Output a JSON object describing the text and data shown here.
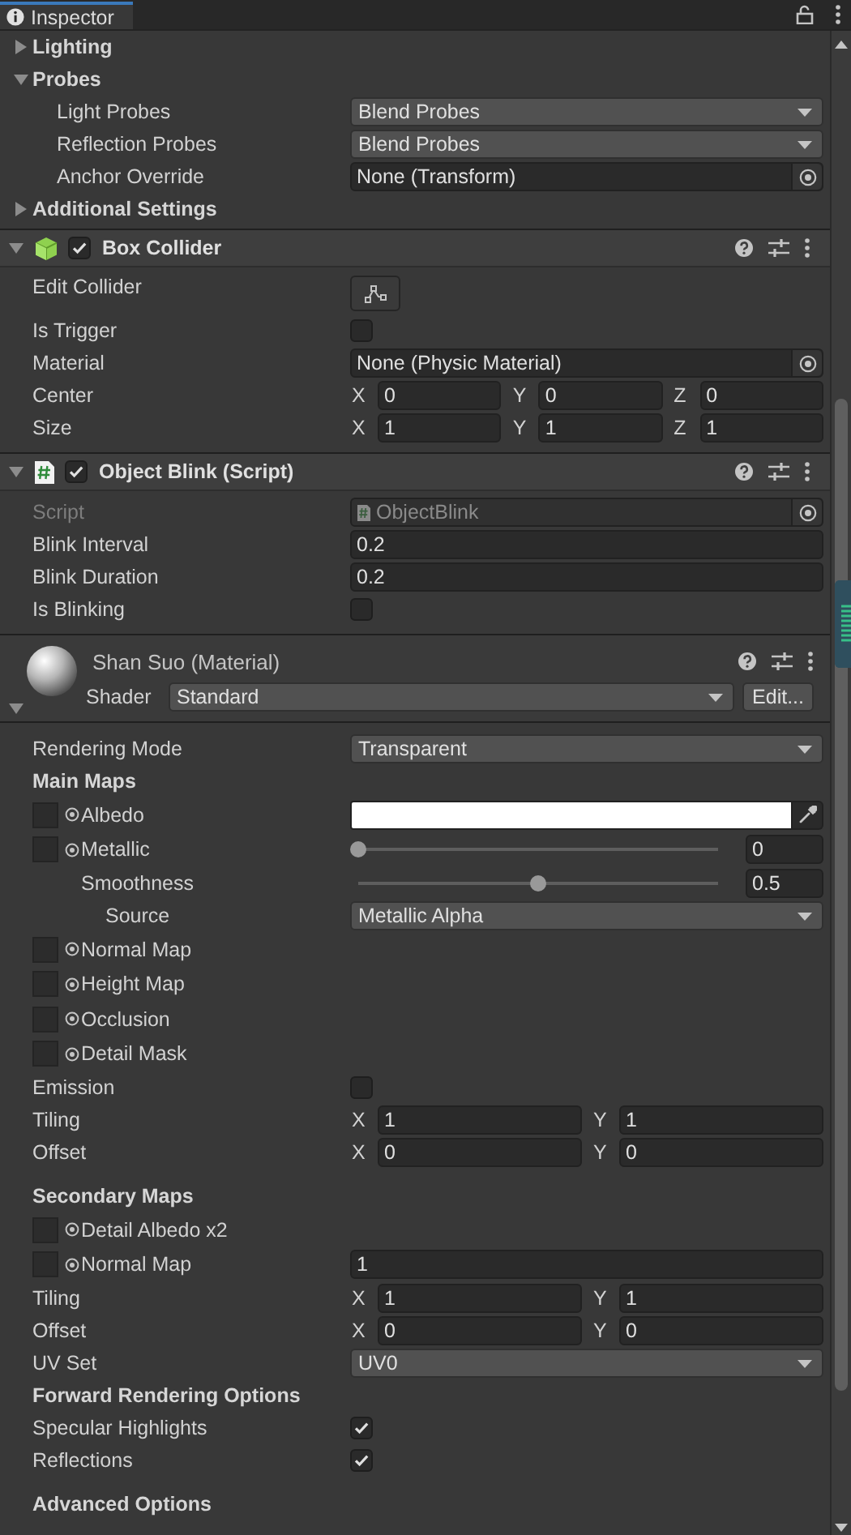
{
  "tab": {
    "title": "Inspector",
    "selected": true
  },
  "components": [
    {
      "kind": "plain",
      "rows": [
        {
          "kind": "foldout",
          "label": "Lighting",
          "expanded": false
        },
        {
          "kind": "foldout",
          "label": "Probes",
          "expanded": true,
          "children": [
            {
              "kind": "dropdown",
              "label": "Light Probes",
              "value": "Blend Probes"
            },
            {
              "kind": "dropdown",
              "label": "Reflection Probes",
              "value": "Blend Probes"
            },
            {
              "kind": "object",
              "label": "Anchor Override",
              "value": "None (Transform)"
            }
          ]
        },
        {
          "kind": "foldout",
          "label": "Additional Settings",
          "expanded": false
        }
      ]
    },
    {
      "kind": "collider",
      "title": "Box Collider",
      "expanded": true,
      "enabled": true,
      "rows": [
        {
          "kind": "button",
          "label": "Edit Collider"
        },
        {
          "kind": "checkbox",
          "label": "Is Trigger",
          "checked": false
        },
        {
          "kind": "object",
          "label": "Material",
          "value": "None (Physic Material)"
        },
        {
          "kind": "vector",
          "label": "Center",
          "fields": [
            {
              "axis": "X",
              "value": "0"
            },
            {
              "axis": "Y",
              "value": "0"
            },
            {
              "axis": "Z",
              "value": "0"
            }
          ]
        },
        {
          "kind": "vector",
          "label": "Size",
          "fields": [
            {
              "axis": "X",
              "value": "1"
            },
            {
              "axis": "Y",
              "value": "1"
            },
            {
              "axis": "Z",
              "value": "1"
            }
          ]
        }
      ]
    },
    {
      "kind": "script",
      "title": "Object Blink (Script)",
      "expanded": true,
      "enabled": true,
      "rows": [
        {
          "kind": "object",
          "label": "Script",
          "value": "ObjectBlink",
          "disabled": true
        },
        {
          "kind": "text",
          "label": "Blink Interval",
          "value": "0.2"
        },
        {
          "kind": "text",
          "label": "Blink Duration",
          "value": "0.2"
        },
        {
          "kind": "checkbox",
          "label": "Is Blinking",
          "checked": false
        }
      ]
    },
    {
      "kind": "material",
      "title": "Shan Suo (Material)",
      "shader_label": "Shader",
      "shader": "Standard",
      "edit_button": "Edit...",
      "expanded": true,
      "rows": [
        {
          "kind": "dropdown",
          "label": "Rendering Mode",
          "value": "Transparent"
        },
        {
          "kind": "header",
          "label": "Main Maps"
        },
        {
          "kind": "texcolor",
          "label": "Albedo",
          "color": "#ffffff"
        },
        {
          "kind": "texslider",
          "label": "Metallic",
          "level": 0,
          "value": "0",
          "children": [
            {
              "kind": "slider",
              "label": "Smoothness",
              "level": 0.5,
              "value": "0.5",
              "children": [
                {
                  "kind": "dropdown",
                  "label": "Source",
                  "value": "Metallic Alpha"
                }
              ]
            }
          ]
        },
        {
          "kind": "texture",
          "label": "Normal Map"
        },
        {
          "kind": "texture",
          "label": "Height Map"
        },
        {
          "kind": "texture",
          "label": "Occlusion"
        },
        {
          "kind": "texture",
          "label": "Detail Mask"
        },
        {
          "kind": "checkbox",
          "label": "Emission",
          "checked": false
        },
        {
          "kind": "vector",
          "label": "Tiling",
          "fields": [
            {
              "axis": "X",
              "value": "1"
            },
            {
              "axis": "Y",
              "value": "1"
            }
          ]
        },
        {
          "kind": "vector",
          "label": "Offset",
          "fields": [
            {
              "axis": "X",
              "value": "0"
            },
            {
              "axis": "Y",
              "value": "0"
            }
          ]
        },
        {
          "kind": "header",
          "label": "Secondary Maps"
        },
        {
          "kind": "texture",
          "label": "Detail Albedo x2"
        },
        {
          "kind": "textext",
          "label": "Normal Map",
          "value": "1"
        },
        {
          "kind": "vector",
          "label": "Tiling",
          "fields": [
            {
              "axis": "X",
              "value": "1"
            },
            {
              "axis": "Y",
              "value": "1"
            }
          ]
        },
        {
          "kind": "vector",
          "label": "Offset",
          "fields": [
            {
              "axis": "X",
              "value": "0"
            },
            {
              "axis": "Y",
              "value": "0"
            }
          ]
        },
        {
          "kind": "dropdown",
          "label": "UV Set",
          "value": "UV0"
        },
        {
          "kind": "header",
          "label": "Forward Rendering Options"
        },
        {
          "kind": "checkbox",
          "label": "Specular Highlights",
          "checked": true
        },
        {
          "kind": "checkbox",
          "label": "Reflections",
          "checked": true
        },
        {
          "kind": "header",
          "label": "Advanced Options"
        }
      ]
    }
  ]
}
